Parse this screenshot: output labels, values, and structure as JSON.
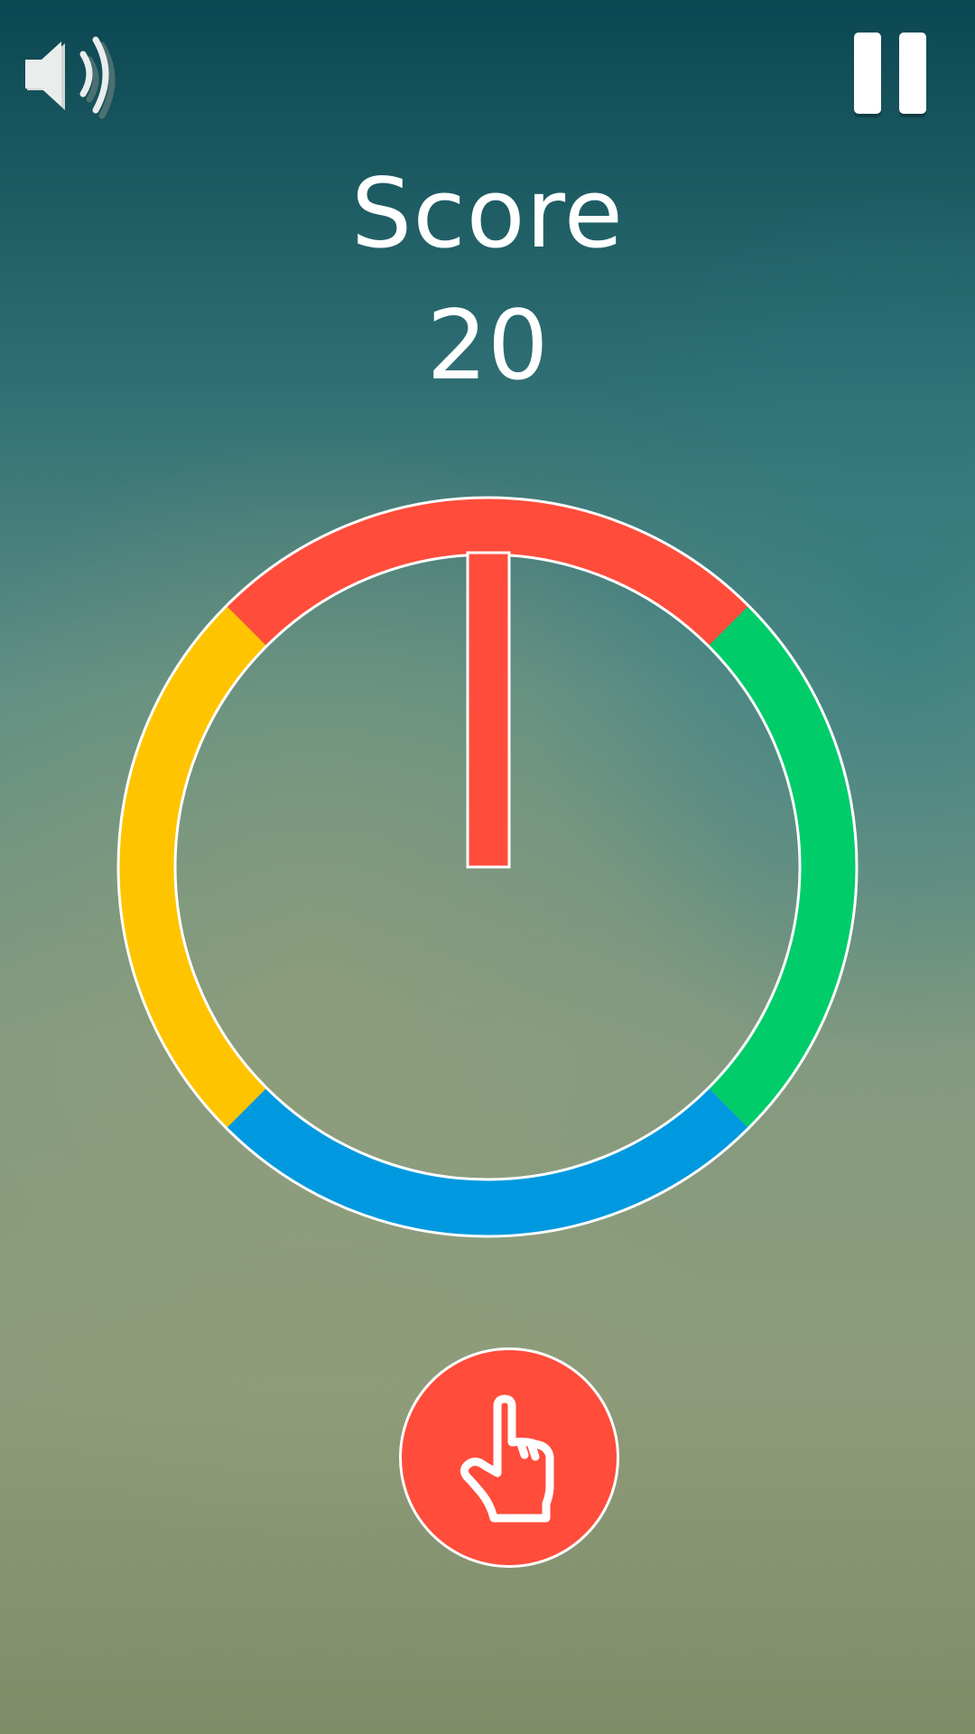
{
  "game": {
    "score_label": "Score",
    "score_value": "20"
  },
  "controls": {
    "sound_icon": "speaker-volume-icon",
    "pause_icon": "pause-icon",
    "tap_icon": "pointing-hand-icon"
  },
  "wheel": {
    "segments": [
      {
        "name": "red",
        "color": "#ff4c3b"
      },
      {
        "name": "green",
        "color": "#00cc6a"
      },
      {
        "name": "blue",
        "color": "#0099e0"
      },
      {
        "name": "yellow",
        "color": "#ffc400"
      }
    ],
    "needle_color": "#ff4c3b"
  },
  "colors": {
    "background_top": "#0b4752",
    "background_bottom": "#7f8c68",
    "tap_button": "#ff4c3b",
    "outline": "#ffffff"
  }
}
